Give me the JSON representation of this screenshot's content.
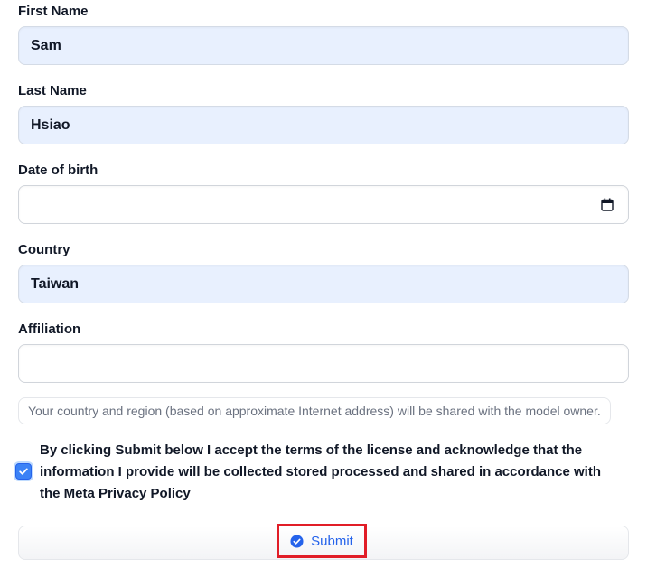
{
  "form": {
    "first_name": {
      "label": "First Name",
      "value": "Sam"
    },
    "last_name": {
      "label": "Last Name",
      "value": "Hsiao"
    },
    "date_of_birth": {
      "label": "Date of birth",
      "value": ""
    },
    "country": {
      "label": "Country",
      "value": "Taiwan"
    },
    "affiliation": {
      "label": "Affiliation",
      "value": ""
    },
    "notice": "Your country and region (based on approximate Internet address) will be shared with the model owner.",
    "consent": {
      "checked": true,
      "text": "By clicking Submit below I accept the terms of the license and acknowledge that the information I provide will be collected stored processed and shared in accordance with the Meta Privacy Policy"
    },
    "submit_label": "Submit"
  },
  "colors": {
    "autofill_bg": "#e8f0fe",
    "accent": "#2563eb",
    "highlight_border": "#e11d27"
  },
  "icons": {
    "date_picker": "calendar-icon",
    "checkbox": "checkmark-icon",
    "submit": "check-circle-icon"
  }
}
